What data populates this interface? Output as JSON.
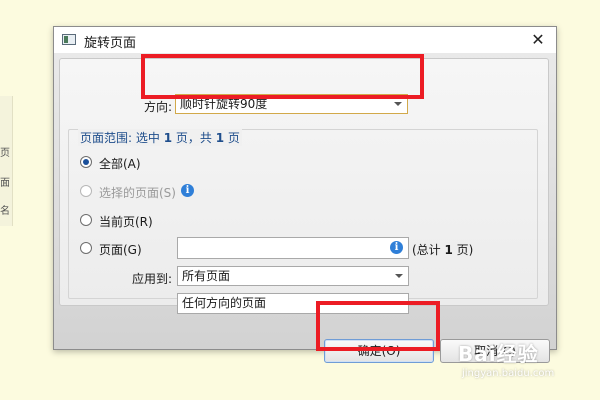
{
  "background": {
    "left_glyphs": [
      "页",
      "面",
      "名"
    ]
  },
  "dialog": {
    "title": "旋转页面",
    "close_glyph": "✕",
    "direction": {
      "label": "方向:",
      "selected": "顺时针旋转90度"
    },
    "page_range": {
      "prefix": "页面范围: 选中 ",
      "selected_count": "1",
      "middle": " 页，共 ",
      "total_count": "1",
      "suffix": " 页"
    },
    "options": {
      "all": "全部(A)",
      "selected_pages": "选择的页面(S)",
      "current_page": "当前页(R)",
      "pages": "页面(G)"
    },
    "pages_input": {
      "value": "",
      "total_prefix": "(总计 ",
      "total_count": "1",
      "total_suffix": " 页)"
    },
    "apply_to": {
      "label": "应用到:",
      "scope": "所有页面",
      "orientation": "任何方向的页面"
    },
    "buttons": {
      "ok": "确定(O)",
      "cancel": "取消(C)"
    }
  },
  "watermark": {
    "brand": "Bai经验",
    "url": "jingyan.baidu.com"
  },
  "colors": {
    "highlight": "#ec1c24",
    "accent_blue": "#1f4e8c",
    "background": "#fcfbdf"
  }
}
